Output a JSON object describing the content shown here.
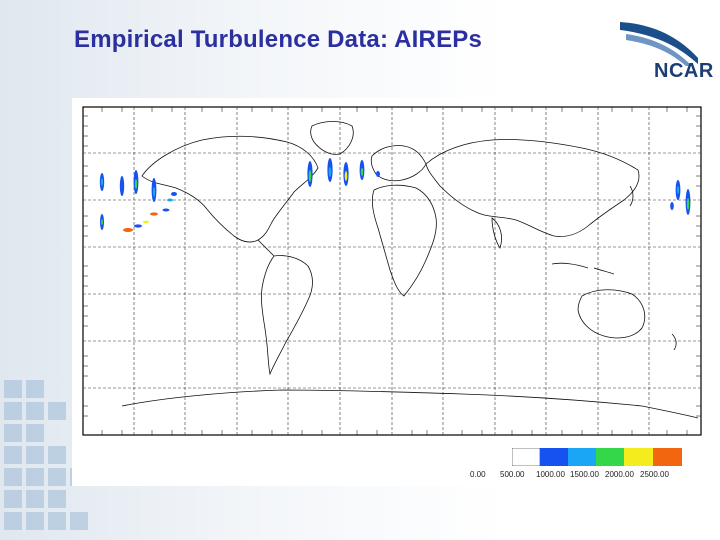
{
  "slide": {
    "title": "Empirical Turbulence Data: AIREPs"
  },
  "logo": {
    "text": "NCAR",
    "icon": "ncar-swoosh-logo",
    "color": "#1b3e74"
  },
  "colorbar": {
    "labels": [
      "0.00",
      "500.00",
      "1000.00",
      "1500.00",
      "2000.00",
      "2500.00"
    ],
    "colors": [
      "#ffffff",
      "#1652f0",
      "#1aa6f5",
      "#34d64a",
      "#f4ec1c",
      "#f2660f"
    ]
  }
}
